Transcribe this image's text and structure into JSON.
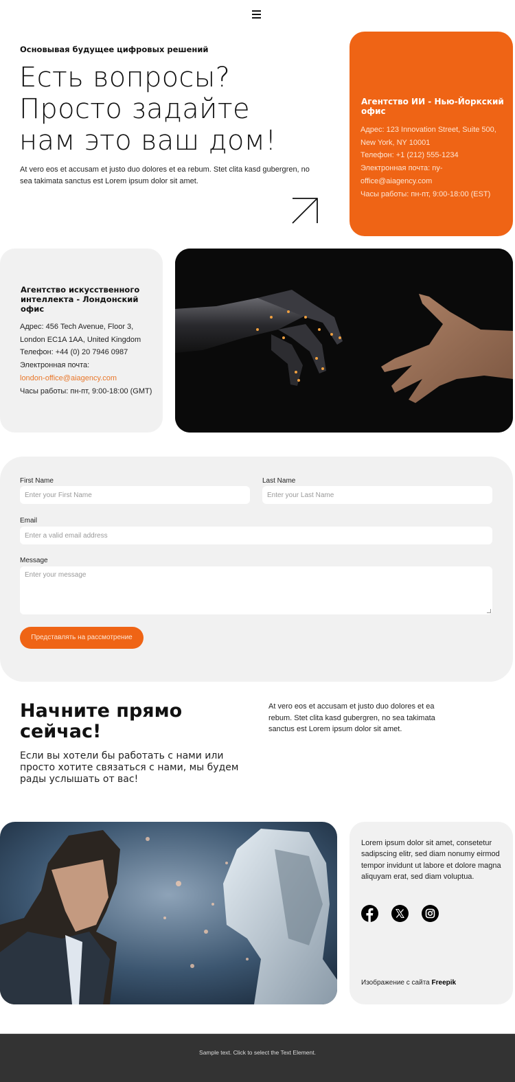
{
  "header": {
    "menu_icon": "hamburger-menu-icon"
  },
  "hero": {
    "subtitle": "Основывая будущее цифровых решений",
    "title_lines": [
      "Есть вопросы?",
      "Просто задайте",
      "нам это ваш дом!"
    ],
    "text": "At vero eos et accusam et justo duo dolores et ea rebum. Stet clita kasd gubergren, no sea takimata sanctus est Lorem ipsum dolor sit amet.",
    "arrow_icon": "arrow-up-right-icon"
  },
  "ny_office": {
    "title": "Агентство ИИ - Нью-Йоркский офис",
    "lines": [
      "Адрес: 123 Innovation Street, Suite 500,",
      "New York, NY 10001",
      "Телефон: +1 (212) 555-1234",
      "Электронная почта: ny-",
      "office@aiagency.com",
      "Часы работы: пн-пт, 9:00-18:00 (EST)"
    ],
    "bg_color": "#ef6415"
  },
  "london_office": {
    "title": "Агентство искусственного интеллекта - Лондонский офис",
    "address_1": "Адрес: 456 Tech Avenue, Floor 3,",
    "address_2": "London EC1A 1AA, United Kingdom",
    "phone": "Телефон: +44 (0) 20 7946 0987",
    "email_label": "Электронная почта:",
    "email": "london-office@aiagency.com",
    "hours": "Часы работы: пн-пт, 9:00-18:00 (GMT)"
  },
  "images": {
    "hands": "robot-and-human-hands-image",
    "robot": "businessman-and-robot-image"
  },
  "form": {
    "first_name": {
      "label": "First Name",
      "placeholder": "Enter your First Name",
      "value": ""
    },
    "last_name": {
      "label": "Last Name",
      "placeholder": "Enter your Last Name",
      "value": ""
    },
    "email": {
      "label": "Email",
      "placeholder": "Enter a valid email address",
      "value": ""
    },
    "message": {
      "label": "Message",
      "placeholder": "Enter your message",
      "value": ""
    },
    "submit_label": "Представлять на рассмотрение"
  },
  "start": {
    "title": "Начните прямо сейчас!",
    "subtitle": "Если вы хотели бы работать с нами или просто хотите связаться с нами, мы будем рады услышать от вас!",
    "text": "At vero eos et accusam et justo duo dolores et ea rebum. Stet clita kasd gubergren, no sea takimata sanctus est Lorem ipsum dolor sit amet."
  },
  "social": {
    "text": "Lorem ipsum dolor sit amet, consetetur sadipscing elitr, sed diam nonumy eirmod tempor invidunt ut labore et dolore magna aliquyam erat, sed diam voluptua.",
    "icons": [
      "facebook-icon",
      "x-twitter-icon",
      "instagram-icon"
    ],
    "credit_prefix": "Изображение с сайта ",
    "credit_link": "Freepik"
  },
  "footer": {
    "text": "Sample text. Click to select the Text Element."
  },
  "colors": {
    "accent": "#ef6415",
    "card_bg": "#f1f1f1",
    "footer_bg": "#333333",
    "link": "#e8772a"
  }
}
